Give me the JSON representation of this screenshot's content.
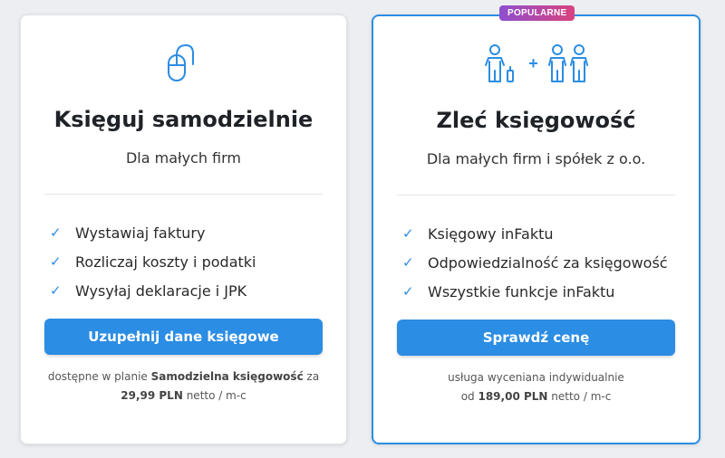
{
  "badge": "POPULARNE",
  "plans": [
    {
      "icon": "mouse-icon",
      "title": "Księguj samodzielnie",
      "subtitle": "Dla małych firm",
      "features": [
        "Wystawiaj faktury",
        "Rozliczaj koszty i podatki",
        "Wysyłaj deklaracje i JPK"
      ],
      "cta": "Uzupełnij dane księgowe",
      "note_prefix": "dostępne w planie",
      "note_plan": "Samodzielna księgowość",
      "note_mid": "za",
      "note_price": "29,99 PLN",
      "note_suffix": "netto / m-c"
    },
    {
      "icon": "people-icon",
      "title": "Zleć księgowość",
      "subtitle": "Dla małych firm i spółek z o.o.",
      "features": [
        "Księgowy inFaktu",
        "Odpowiedzialność za księgowość",
        "Wszystkie funkcje inFaktu"
      ],
      "cta": "Sprawdź cenę",
      "note_line1": "usługa wyceniana indywidualnie",
      "note_from": "od",
      "note_price": "189,00 PLN",
      "note_suffix": "netto / m-c",
      "plus": "+"
    }
  ],
  "colors": {
    "accent": "#2b8de3",
    "badge_from": "#8e4fd0",
    "badge_to": "#d9437e"
  }
}
